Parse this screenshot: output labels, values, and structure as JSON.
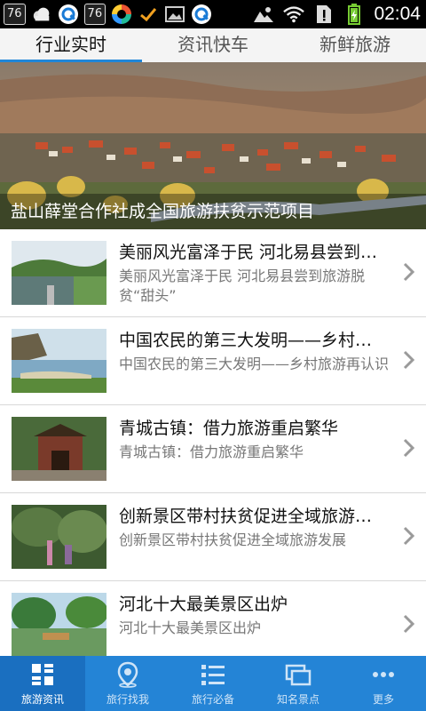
{
  "status_bar": {
    "badge_left": "76",
    "badge_mid": "76",
    "time": "02:04"
  },
  "tabs": [
    {
      "label": "行业实时",
      "active": true
    },
    {
      "label": "资讯快车",
      "active": false
    },
    {
      "label": "新鲜旅游",
      "active": false
    }
  ],
  "hero": {
    "caption": "盐山薛堂合作社成全国旅游扶贫示范项目"
  },
  "articles": [
    {
      "title": "美丽风光富泽于民 河北易县尝到旅游脱贫“甜头”",
      "desc": "美丽风光富泽于民 河北易县尝到旅游脱贫“甜头”"
    },
    {
      "title": "中国农民的第三大发明——乡村旅游再认识",
      "desc": "中国农民的第三大发明——乡村旅游再认识"
    },
    {
      "title": "青城古镇：借力旅游重启繁华",
      "desc": "青城古镇：借力旅游重启繁华"
    },
    {
      "title": "创新景区带村扶贫促进全域旅游发展",
      "desc": "创新景区带村扶贫促进全域旅游发展"
    },
    {
      "title": "河北十大最美景区出炉",
      "desc": "河北十大最美景区出炉"
    }
  ],
  "bottom_nav": [
    {
      "label": "旅游资讯",
      "icon": "grid-icon",
      "active": true
    },
    {
      "label": "旅行找我",
      "icon": "location-pin-icon",
      "active": false
    },
    {
      "label": "旅行必备",
      "icon": "list-icon",
      "active": false
    },
    {
      "label": "知名景点",
      "icon": "windows-icon",
      "active": false
    },
    {
      "label": "更多",
      "icon": "more-dots-icon",
      "active": false
    }
  ],
  "colors": {
    "accent": "#1f86d8",
    "nav_bg": "#2484d6",
    "nav_active": "#1a6fc0"
  }
}
